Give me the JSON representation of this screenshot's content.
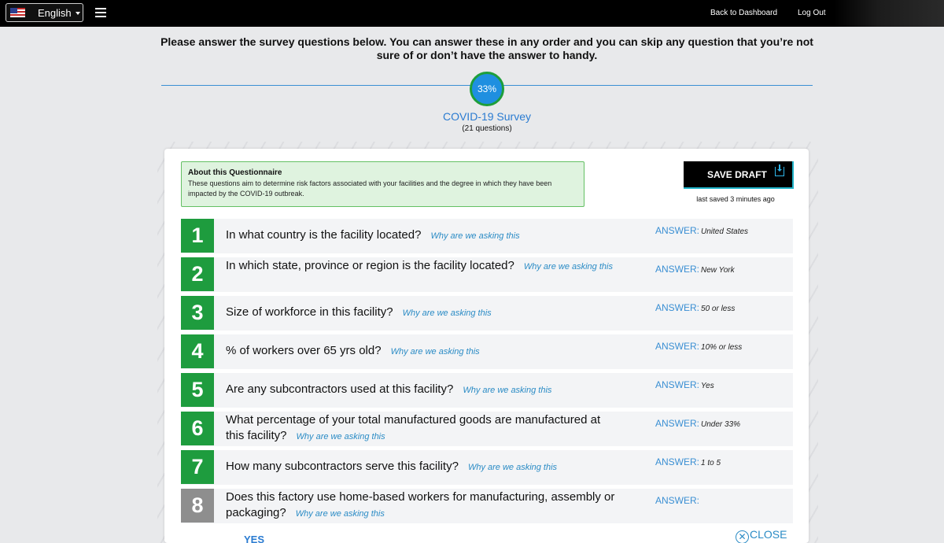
{
  "topbar": {
    "language": "English",
    "language_flag": "us-flag-icon",
    "back_link": "Back to Dashboard",
    "logout_link": "Log Out"
  },
  "intro": "Please answer the survey questions below. You can answer these in any order and you can skip any question that you’re not sure of or don’t have the answer to handy.",
  "progress": {
    "label": "33%",
    "value": 0.33
  },
  "survey": {
    "title": "COVID-19 Survey",
    "count": "(21 questions)"
  },
  "about": {
    "heading": "About this Questionnaire",
    "text": "These questions aim to determine risk factors associated with your facilities and the degree in which they have been impacted by the COVID-19 outbreak."
  },
  "save": {
    "label": "SAVE DRAFT",
    "last_saved": "last saved 3 minutes ago"
  },
  "answer_label": "ANSWER:",
  "why_label": "Why are we asking this",
  "questions": [
    {
      "num": "1",
      "text": "In what country is the facility located?",
      "answer": "United States"
    },
    {
      "num": "2",
      "text": "In which state, province or region is the facility located?",
      "answer": "New York"
    },
    {
      "num": "3",
      "text": "Size of workforce in this facility?",
      "answer": "50 or less"
    },
    {
      "num": "4",
      "text": "% of workers over 65 yrs old?",
      "answer": "10% or less"
    },
    {
      "num": "5",
      "text": "Are any subcontractors used at this facility?",
      "answer": "Yes"
    },
    {
      "num": "6",
      "text": "What percentage of your total manufactured goods are manufactured at this facility?",
      "answer": "Under 33%"
    },
    {
      "num": "7",
      "text": "How many subcontractors serve this facility?",
      "answer": "1 to 5"
    },
    {
      "num": "8",
      "text": "Does this factory use home-based workers for manufacturing, assembly or packaging?",
      "answer": ""
    }
  ],
  "footer": {
    "yes_option": "YES",
    "close_label": "CLOSE"
  },
  "colors": {
    "accent_green": "#1e9c3e",
    "accent_blue": "#2a7bd1",
    "inactive_grey": "#8e8e8e"
  }
}
